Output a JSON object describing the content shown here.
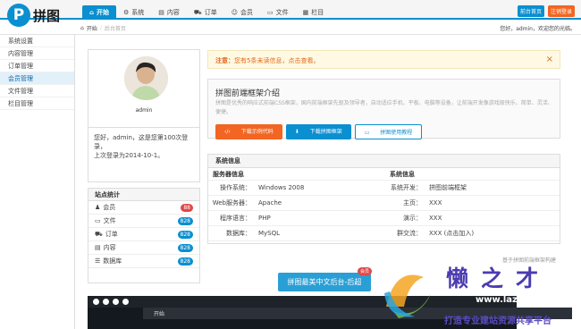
{
  "logo": {
    "mark": "P",
    "text": "拼图"
  },
  "nav": [
    {
      "label": "开始"
    },
    {
      "label": "系统"
    },
    {
      "label": "内容"
    },
    {
      "label": "订单"
    },
    {
      "label": "会员"
    },
    {
      "label": "文件"
    },
    {
      "label": "栏目"
    }
  ],
  "top_buttons": {
    "preview": "前台首页",
    "logout": "注销登录"
  },
  "breadcrumb": {
    "home": "开始",
    "current": "后台首页"
  },
  "user_info": "您好，admin，欢迎您的光临。",
  "sidebar": [
    {
      "label": "系统设置"
    },
    {
      "label": "内容管理"
    },
    {
      "label": "订单管理"
    },
    {
      "label": "会员管理"
    },
    {
      "label": "文件管理"
    },
    {
      "label": "栏目管理"
    }
  ],
  "profile": {
    "username": "admin",
    "welcome_line1": "您好，admin，这是您第100次登录，",
    "welcome_line2": "上次登录为2014-10-1。"
  },
  "stats": {
    "title": "站点统计",
    "rows": [
      {
        "label": "会员",
        "count": "88",
        "color": "#e04848"
      },
      {
        "label": "文件",
        "count": "828",
        "color": "#0a8fd0"
      },
      {
        "label": "订单",
        "count": "828",
        "color": "#0a8fd0"
      },
      {
        "label": "内容",
        "count": "828",
        "color": "#0a8fd0"
      },
      {
        "label": "数据库",
        "count": "828",
        "color": "#0a8fd0"
      }
    ]
  },
  "alert": {
    "strong": "注意：",
    "text": "您有5条未读信息，点击查看。"
  },
  "intro": {
    "title": "拼图前端框架介绍",
    "description": "拼图是优秀的响应式前端CSS框架，国内前端框架先驱及领导者，自动适应手机、平板、电脑等设备，让前端开发像游戏般快乐、简单、灵活、便捷。",
    "buttons": [
      "下载示例代码",
      "下载拼图框架",
      "拼图使用教程"
    ]
  },
  "sysinfo": {
    "title": "系统信息",
    "col_left": "服务器信息",
    "col_right": "系统信息",
    "rows": [
      {
        "k1": "操作系统：",
        "v1": "Windows 2008",
        "k2": "系统开发：",
        "v2": "拼图前端框架"
      },
      {
        "k1": "Web服务器：",
        "v1": "Apache",
        "k2": "主页：",
        "v2": "XXX"
      },
      {
        "k1": "程序语言：",
        "v1": "PHP",
        "k2": "演示：",
        "v2": "XXX"
      },
      {
        "k1": "数据库：",
        "v1": "MySQL",
        "k2": "群交流：",
        "v2": "XXX (点击加入)"
      }
    ]
  },
  "footer_note": "基于拼图前端框架构建",
  "promo": {
    "label": "拼图最美中文后台-后超",
    "badge": "会员"
  },
  "preview_tab": "开始",
  "watermark": {
    "text": "懒之才",
    "url": "www.lazhanzhe.com",
    "slogan": "打造专业建站资源共享平台"
  },
  "colors": {
    "accent": "#0a8fd0",
    "orange": "#f26522",
    "red": "#e04848"
  }
}
